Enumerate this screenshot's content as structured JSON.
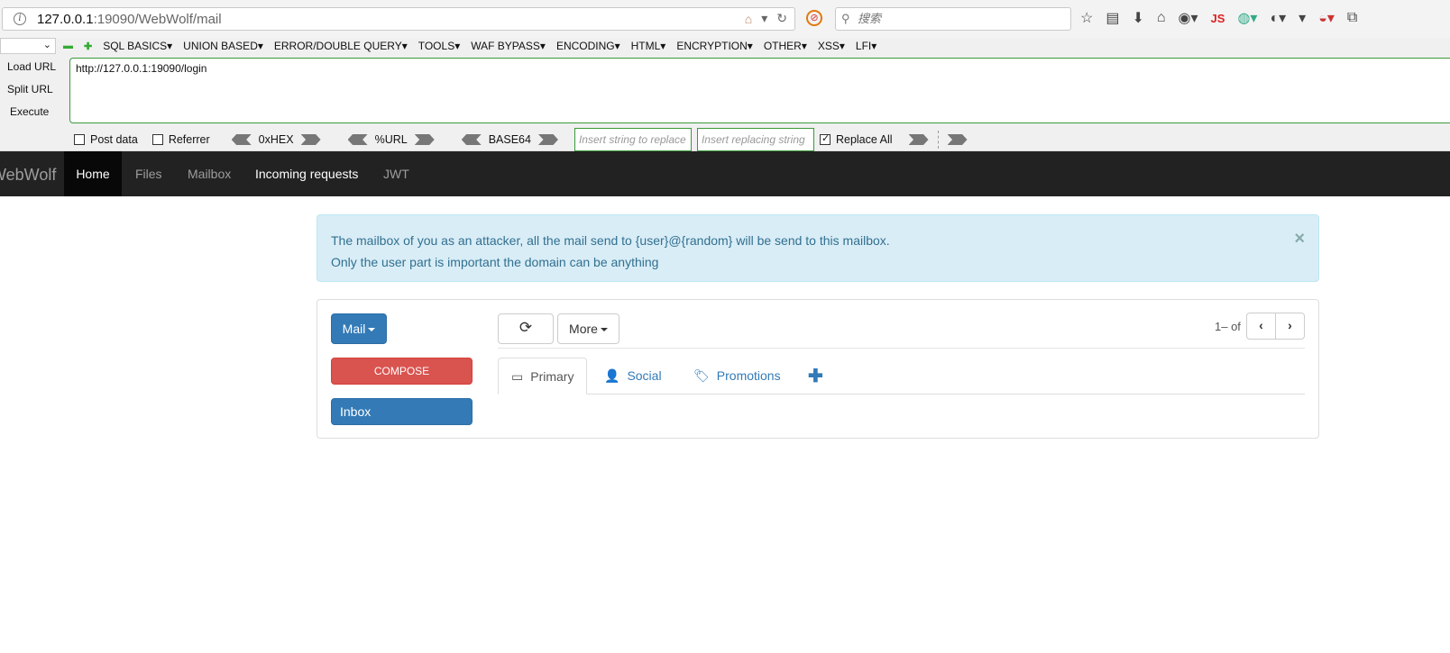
{
  "browser": {
    "url_host": "127.0.0.1",
    "url_rest": ":19090/WebWolf/mail",
    "search_placeholder": "搜索",
    "js_label": "JS"
  },
  "hackbar": {
    "menu": [
      "SQL BASICS▾",
      "UNION BASED▾",
      "ERROR/DOUBLE QUERY▾",
      "TOOLS▾",
      "WAF BYPASS▾",
      "ENCODING▾",
      "HTML▾",
      "ENCRYPTION▾",
      "OTHER▾",
      "XSS▾",
      "LFI▾"
    ],
    "load_url": "Load URL",
    "split_url": "Split URL",
    "execute": "Execute",
    "url_value": "http://127.0.0.1:19090/login",
    "post_data": "Post data",
    "referrer": "Referrer",
    "hex": "0xHEX",
    "urlenc": "%URL",
    "base64": "BASE64",
    "replace_placeholder": "Insert string to replace",
    "replacing_placeholder": "Insert replacing string",
    "replace_all": "Replace All"
  },
  "navbar": {
    "brand": "WebWolf",
    "items": [
      "Home",
      "Files",
      "Mailbox",
      "Incoming requests",
      "JWT"
    ]
  },
  "alert": {
    "line1": "The mailbox of you as an attacker, all the mail send to {user}@{random} will be send to this mailbox.",
    "line2": "Only the user part is important the domain can be anything",
    "close": "×"
  },
  "mail": {
    "mail_button": "Mail",
    "compose": "COMPOSE",
    "inbox": "Inbox",
    "more": "More",
    "pager": "1– of",
    "tabs": [
      "Primary",
      "Social",
      "Promotions"
    ]
  }
}
